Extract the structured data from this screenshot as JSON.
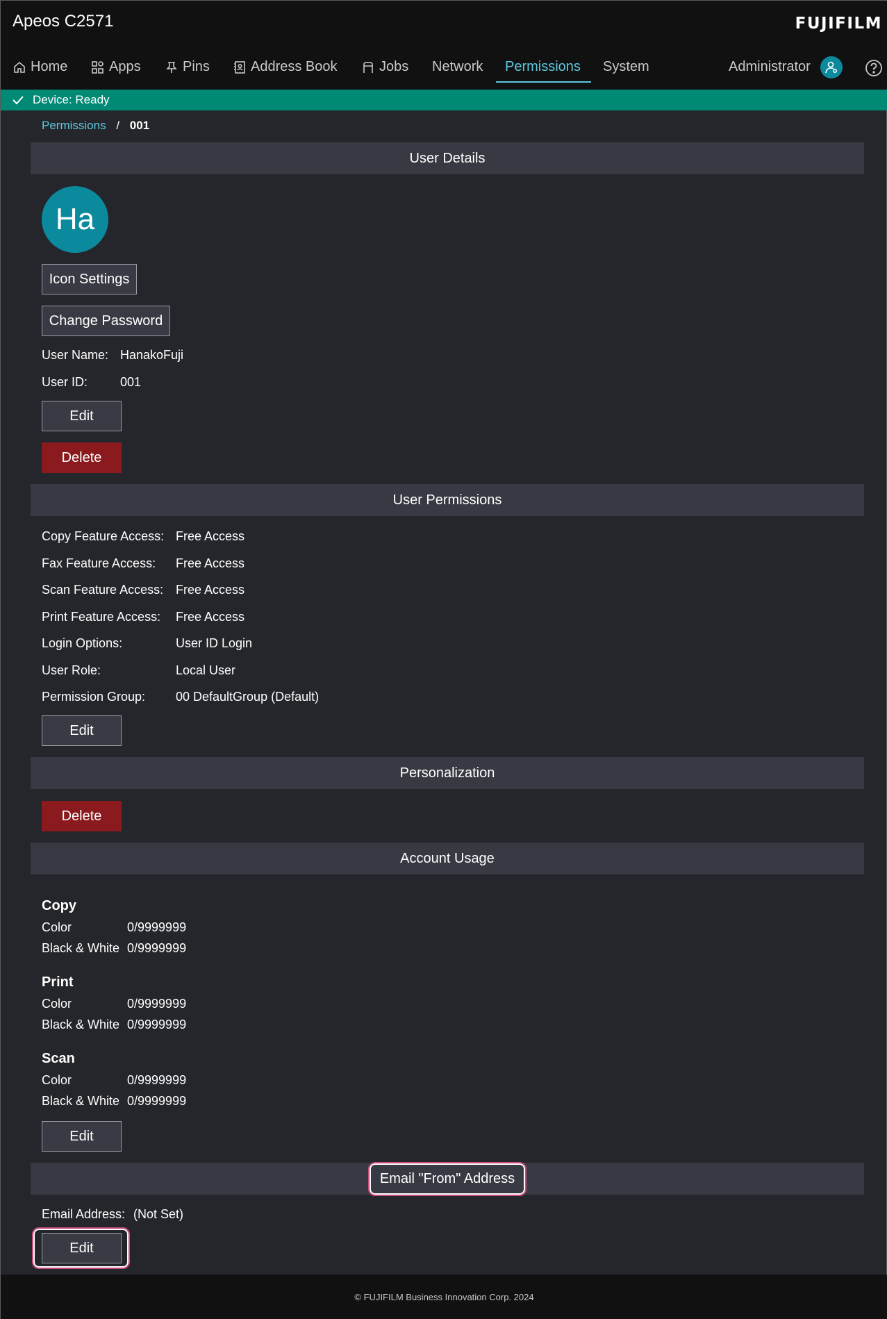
{
  "app": {
    "title": "Apeos C2571",
    "brand": "FUJIFILM"
  },
  "nav": {
    "items": [
      {
        "label": "Home",
        "icon": "home-icon"
      },
      {
        "label": "Apps",
        "icon": "apps-icon"
      },
      {
        "label": "Pins",
        "icon": "pin-icon"
      },
      {
        "label": "Address Book",
        "icon": "address-book-icon"
      },
      {
        "label": "Jobs",
        "icon": "jobs-icon"
      },
      {
        "label": "Network"
      },
      {
        "label": "Permissions",
        "active": true
      },
      {
        "label": "System"
      }
    ],
    "user": "Administrator"
  },
  "status": {
    "text": "Device: Ready",
    "color": "#008975"
  },
  "breadcrumb": {
    "parent": "Permissions",
    "sep": "/",
    "current": "001"
  },
  "user_details": {
    "header": "User Details",
    "avatar_initials": "Ha",
    "icon_settings_label": "Icon Settings",
    "change_password_label": "Change Password",
    "user_name_label": "User Name:",
    "user_name": "HanakoFuji",
    "user_id_label": "User ID:",
    "user_id": "001",
    "edit_label": "Edit",
    "delete_label": "Delete"
  },
  "user_permissions": {
    "header": "User Permissions",
    "rows": [
      {
        "label": "Copy Feature Access:",
        "value": "Free Access"
      },
      {
        "label": "Fax Feature Access:",
        "value": "Free Access"
      },
      {
        "label": "Scan Feature Access:",
        "value": "Free Access"
      },
      {
        "label": "Print Feature Access:",
        "value": "Free Access"
      },
      {
        "label": "Login Options:",
        "value": "User ID Login"
      },
      {
        "label": "User Role:",
        "value": "Local User"
      },
      {
        "label": "Permission Group:",
        "value": "00 DefaultGroup (Default)"
      }
    ],
    "edit_label": "Edit"
  },
  "personalization": {
    "header": "Personalization",
    "delete_label": "Delete"
  },
  "account_usage": {
    "header": "Account Usage",
    "groups": [
      {
        "title": "Copy",
        "color_label": "Color",
        "color_value": "0/9999999",
        "bw_label": "Black & White",
        "bw_value": "0/9999999"
      },
      {
        "title": "Print",
        "color_label": "Color",
        "color_value": "0/9999999",
        "bw_label": "Black & White",
        "bw_value": "0/9999999"
      },
      {
        "title": "Scan",
        "color_label": "Color",
        "color_value": "0/9999999",
        "bw_label": "Black & White",
        "bw_value": "0/9999999"
      }
    ],
    "edit_label": "Edit"
  },
  "email_from": {
    "header": "Email \"From\" Address",
    "label": "Email Address:",
    "value": "(Not Set)",
    "edit_label": "Edit"
  },
  "footer": {
    "text": "© FUJIFILM Business Innovation Corp. 2024"
  },
  "colors": {
    "accent": "#5ec8e0",
    "danger": "#8a1a1e",
    "highlight": "#c94c7a",
    "avatar": "#0b8a9e"
  }
}
